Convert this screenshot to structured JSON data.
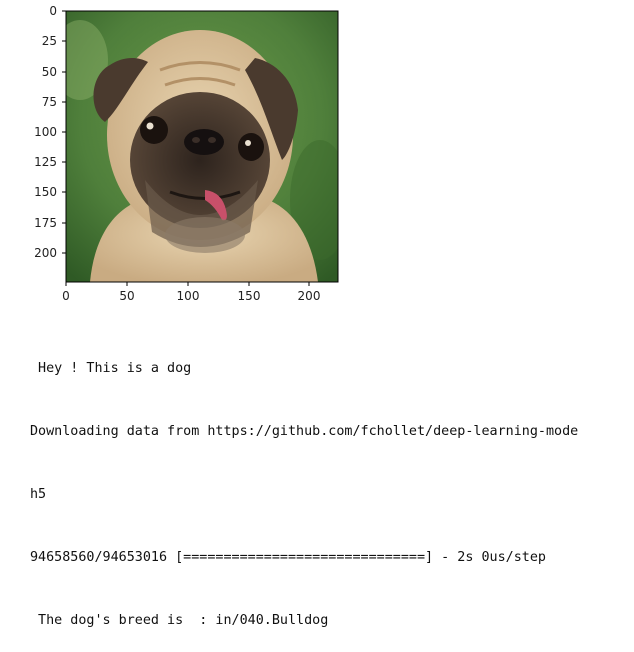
{
  "figure": {
    "image_subject": "pug-dog-photo",
    "y_ticks": [
      "0",
      "25",
      "50",
      "75",
      "100",
      "125",
      "150",
      "175",
      "200"
    ],
    "x_ticks": [
      "0",
      "50",
      "100",
      "150",
      "200"
    ],
    "colors": {
      "background_green": "#4f7f3b",
      "fur": "#dcc49c",
      "mask": "#3e3128",
      "tongue": "#c8506a"
    }
  },
  "output": {
    "lines": [
      " Hey ! This is a dog",
      "Downloading data from https://github.com/fchollet/deep-learning-mode",
      "h5",
      "94658560/94653016 [==============================] - 2s 0us/step",
      " The dog's breed is  : in/040.Bulldog"
    ]
  }
}
